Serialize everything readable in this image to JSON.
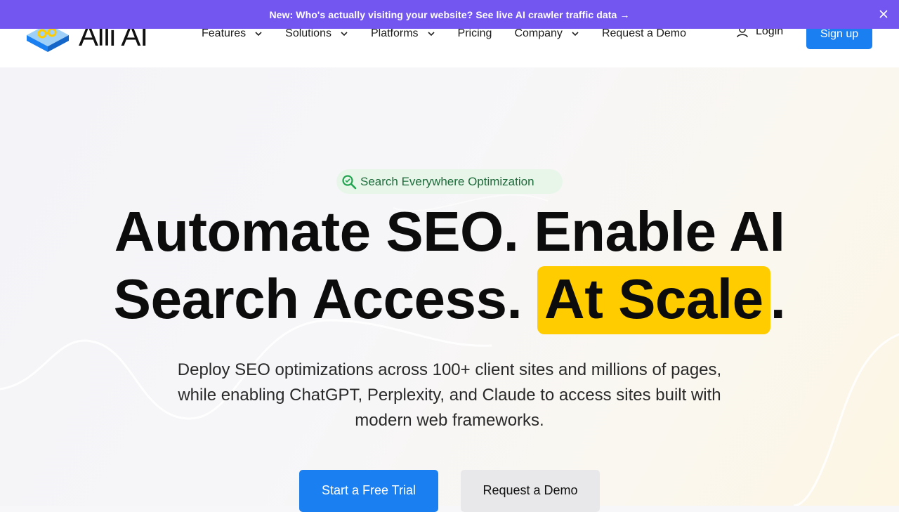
{
  "announcement": {
    "text": "New: Who's actually visiting your website? See live AI crawler traffic data →",
    "close_icon": "close-icon"
  },
  "header": {
    "logo_text": "Alli AI",
    "nav": [
      {
        "label": "Features",
        "has_dropdown": true
      },
      {
        "label": "Solutions",
        "has_dropdown": true
      },
      {
        "label": "Platforms",
        "has_dropdown": true
      },
      {
        "label": "Pricing",
        "has_dropdown": false
      },
      {
        "label": "Company",
        "has_dropdown": true
      },
      {
        "label": "Request a Demo",
        "has_dropdown": false
      }
    ],
    "login_label": "Login",
    "signup_label": "Sign up"
  },
  "hero": {
    "pill_label": "Search Everywhere Optimization",
    "headline_line1": "Automate SEO. Enable AI",
    "headline_line2_start": "Search Access. ",
    "headline_highlight": "At Scale",
    "headline_line2_end": ".",
    "subheadline": "Deploy SEO optimizations across 100+ client sites and millions of pages, while enabling ChatGPT, Perplexity, and Claude to access sites built with modern web frameworks.",
    "cta_primary": "Start a Free Trial",
    "cta_secondary": "Request a Demo"
  },
  "colors": {
    "announcement_bg": "#7356f0",
    "primary_blue": "#1a7ff0",
    "highlight_yellow": "#ffcc00",
    "pill_bg": "#e8f6ea",
    "pill_text": "#1d6b3a"
  }
}
